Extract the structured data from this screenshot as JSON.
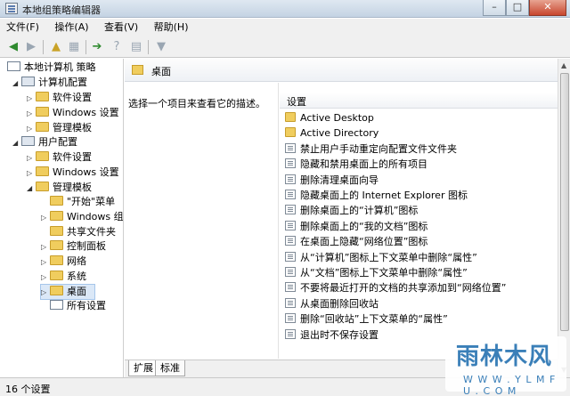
{
  "window": {
    "title": "本地组策略编辑器",
    "buttons": {
      "minimize": "–",
      "maximize": "□",
      "close": "✕"
    }
  },
  "menu": [
    "文件(F)",
    "操作(A)",
    "查看(V)",
    "帮助(H)"
  ],
  "tree": {
    "root": "本地计算机 策略",
    "computer_config": "计算机配置",
    "cc_items": [
      "软件设置",
      "Windows 设置",
      "管理模板"
    ],
    "user_config": "用户配置",
    "uc_items": [
      "软件设置",
      "Windows 设置",
      "管理模板"
    ],
    "admin_templates": [
      "\"开始\"菜单",
      "Windows 组",
      "共享文件夹",
      "控制面板",
      "网络",
      "系统",
      "桌面",
      "所有设置"
    ]
  },
  "right": {
    "header": "桌面",
    "description": "选择一个项目来查看它的描述。",
    "column_header": "设置",
    "items": [
      {
        "label": "Active Desktop",
        "icon": "folder-icon"
      },
      {
        "label": "Active Directory",
        "icon": "folder-icon"
      },
      {
        "label": "禁止用户手动重定向配置文件文件夹",
        "icon": "policy-icon"
      },
      {
        "label": "隐藏和禁用桌面上的所有项目",
        "icon": "policy-icon"
      },
      {
        "label": "删除清理桌面向导",
        "icon": "policy-icon"
      },
      {
        "label": "隐藏桌面上的 Internet Explorer 图标",
        "icon": "policy-icon"
      },
      {
        "label": "删除桌面上的“计算机”图标",
        "icon": "policy-icon"
      },
      {
        "label": "删除桌面上的“我的文档”图标",
        "icon": "policy-icon"
      },
      {
        "label": "在桌面上隐藏“网络位置”图标",
        "icon": "policy-icon"
      },
      {
        "label": "从“计算机”图标上下文菜单中删除“属性”",
        "icon": "policy-icon"
      },
      {
        "label": "从“文档”图标上下文菜单中删除“属性”",
        "icon": "policy-icon"
      },
      {
        "label": "不要将最近打开的文档的共享添加到“网络位置”",
        "icon": "policy-icon"
      },
      {
        "label": "从桌面删除回收站",
        "icon": "policy-icon"
      },
      {
        "label": "删除“回收站”上下文菜单的“属性”",
        "icon": "policy-icon"
      },
      {
        "label": "退出时不保存设置",
        "icon": "policy-icon"
      }
    ]
  },
  "tabs": [
    "扩展",
    "标准"
  ],
  "status": "16 个设置",
  "watermark": {
    "main": "雨林木风",
    "sub": "W W W . Y L M F U . C O M"
  },
  "colors": {
    "folder": "#f0cd5e",
    "selection": "#dbe8f7",
    "watermark": "#3a7fb8"
  }
}
